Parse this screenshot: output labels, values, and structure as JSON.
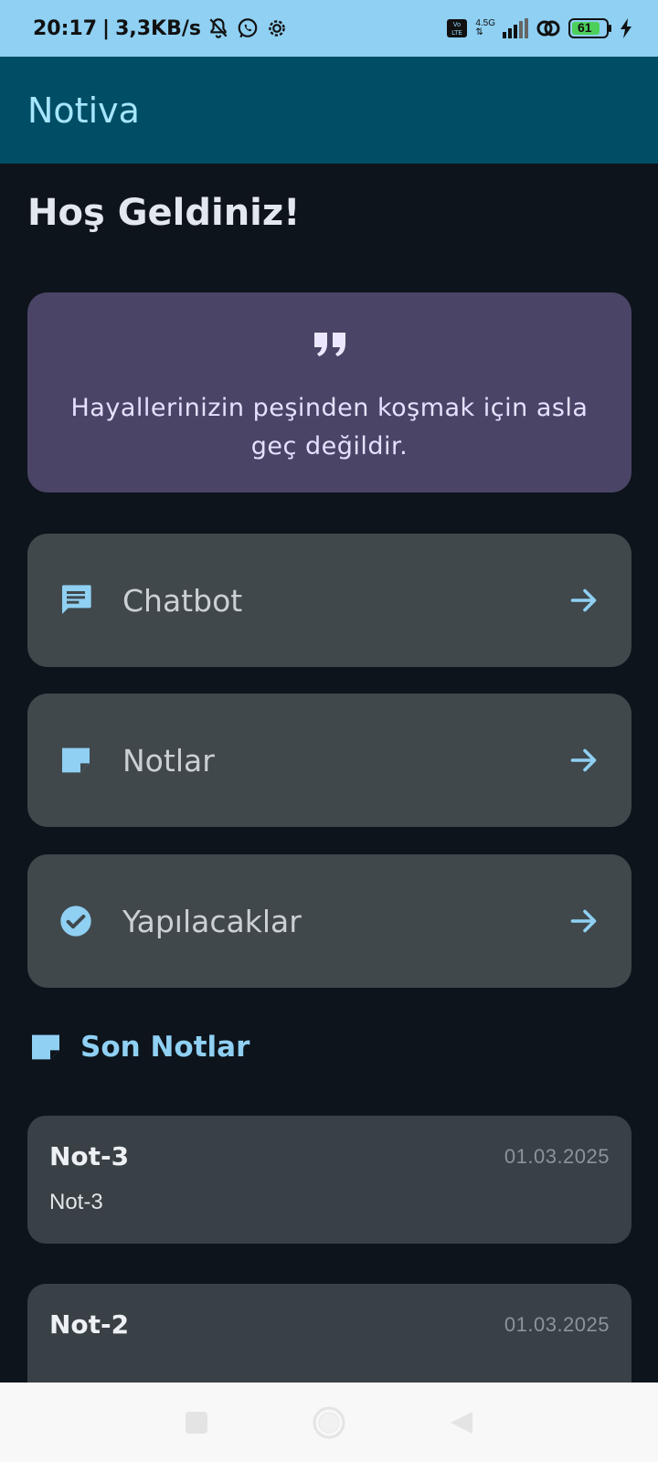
{
  "status_bar": {
    "time": "20:17",
    "speed": "3,3KB/s",
    "network": "4.5G",
    "battery": "61",
    "icons": [
      "mute-bell-icon",
      "whatsapp-icon",
      "gear-icon",
      "volte-icon",
      "signal-icon",
      "link-icon",
      "battery-icon",
      "charging-icon"
    ]
  },
  "app": {
    "title": "Notiva"
  },
  "greeting": "Hoş Geldiniz!",
  "quote": {
    "icon": "quote-icon",
    "text": "Hayallerinizin peşinden koşmak için asla geç değildir."
  },
  "nav_cards": [
    {
      "label": "Chatbot",
      "icon": "chat-icon"
    },
    {
      "label": "Notlar",
      "icon": "note-icon"
    },
    {
      "label": "Yapılacaklar",
      "icon": "check-circle-icon"
    }
  ],
  "recent_notes": {
    "title": "Son Notlar",
    "items": [
      {
        "title": "Not-3",
        "date": "01.03.2025",
        "content": "Not-3"
      },
      {
        "title": "Not-2",
        "date": "01.03.2025",
        "content": ""
      }
    ]
  },
  "system_nav": [
    "square-icon",
    "circle-icon",
    "back-triangle-icon"
  ],
  "colors": {
    "accent": "#8fd0f3",
    "appbar": "#004e65",
    "background": "#0d141b",
    "quote_card": "#4a4466",
    "nav_card": "#40484c",
    "note_card": "#394046"
  }
}
